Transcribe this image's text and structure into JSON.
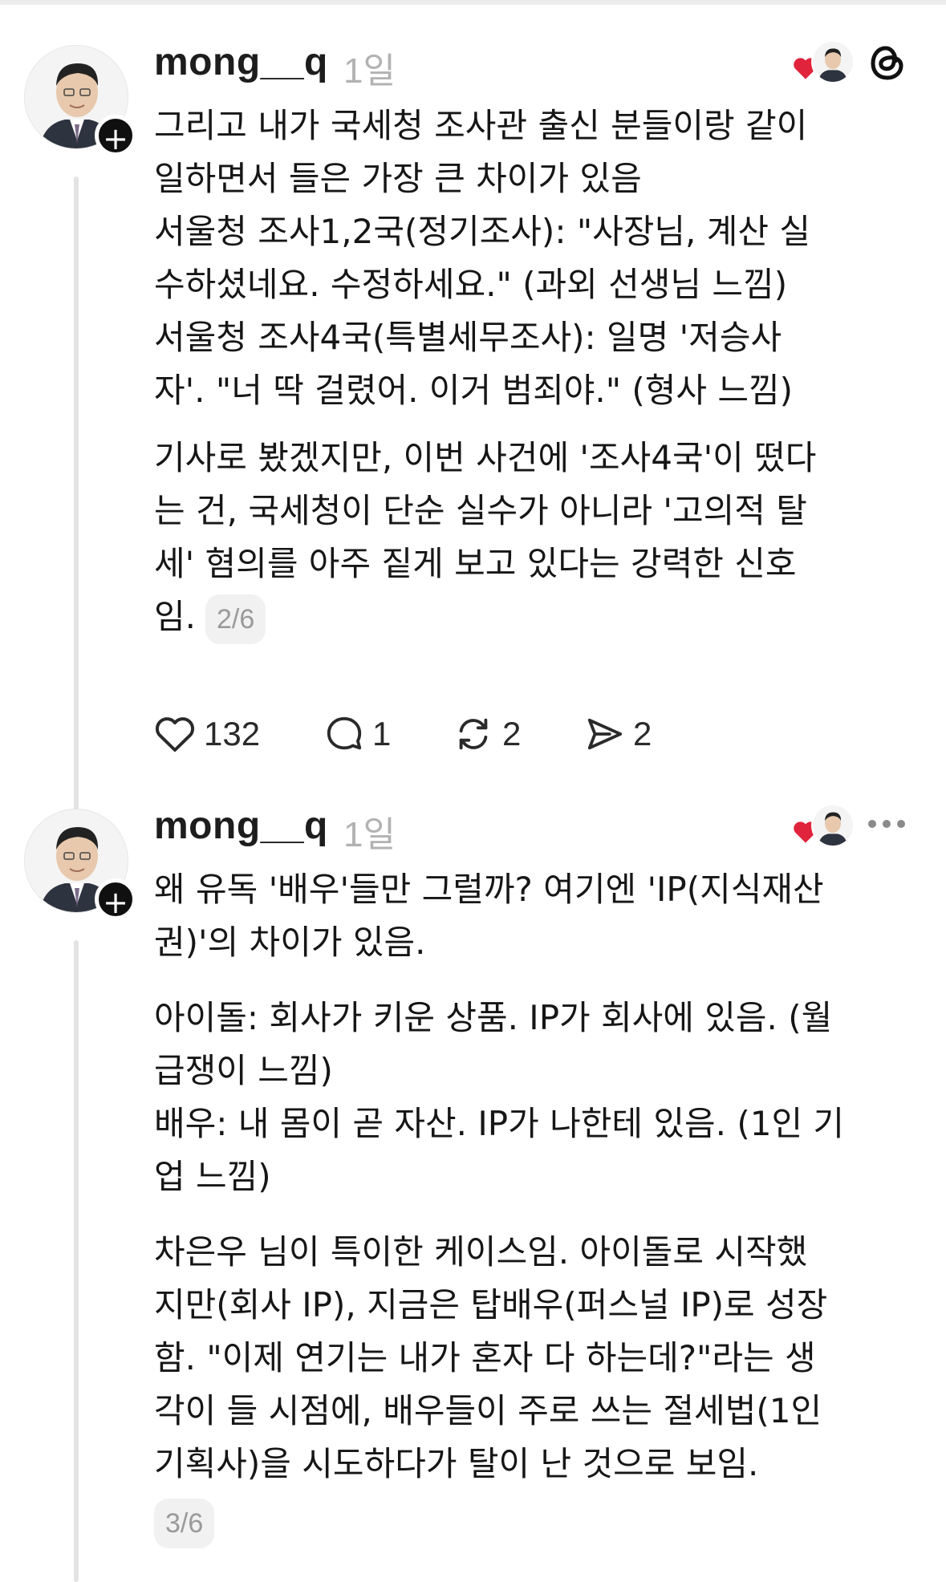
{
  "posts": [
    {
      "username": "mong__q",
      "time": "1일",
      "page": "2/6",
      "lines": [
        "그리고 내가 국세청 조사관 출신 분들이랑 같이",
        "일하면서 들은 가장 큰 차이가 있음",
        "서울청 조사1,2국(정기조사): \"사장님, 계산 실",
        "수하셨네요. 수정하세요.\" (과외 선생님 느낌)",
        "서울청 조사4국(특별세무조사): 일명 '저승사",
        "자'. \"너 딱 걸렸어. 이거 범죄야.\" (형사 느낌)",
        "",
        "기사로 봤겠지만, 이번 사건에 '조사4국'이 떴다",
        "는 건, 국세청이 단순 실수가 아니라 '고의적 탈",
        "세' 혐의를 아주 짙게 보고 있다는 강력한 신호"
      ],
      "last_line": "임.",
      "actions": {
        "likes": "132",
        "replies": "1",
        "reposts": "2",
        "shares": "2"
      }
    },
    {
      "username": "mong__q",
      "time": "1일",
      "page": "3/6",
      "lines": [
        "왜 유독 '배우'들만 그럴까? 여기엔 'IP(지식재산",
        "권)'의 차이가 있음.",
        "",
        "아이돌: 회사가 키운 상품. IP가 회사에 있음. (월",
        "급쟁이 느낌)",
        "배우: 내 몸이 곧 자산. IP가 나한테 있음. (1인 기",
        "업 느낌)",
        "",
        "차은우 님이 특이한 케이스임. 아이돌로 시작했",
        "지만(회사 IP), 지금은 탑배우(퍼스널 IP)로 성장",
        "함. \"이제 연기는 내가 혼자 다 하는데?\"라는 생",
        "각이 들 시점에, 배우들이 주로 쓰는 절세법(1인",
        "기획사)을 시도하다가 탈이 난 것으로 보임."
      ]
    }
  ],
  "icons": {
    "heart_color": "#e0243b",
    "threads_logo": "threads-logo-icon",
    "more": "more-options-icon"
  }
}
